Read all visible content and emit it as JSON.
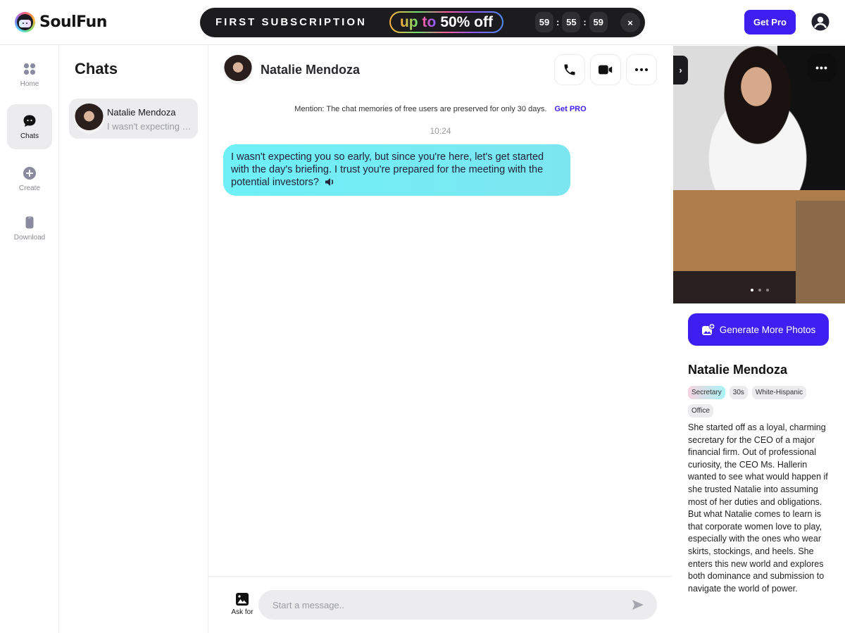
{
  "app": {
    "name": "SoulFun"
  },
  "promo": {
    "title": "FIRST SUBSCRIPTION",
    "pill_up": "up",
    "pill_to": "to",
    "pill_discount": "50% off",
    "timer": [
      "59",
      "55",
      "59"
    ],
    "timer_separator": ":",
    "close_label": "×"
  },
  "header": {
    "get_pro_label": "Get Pro",
    "user_icon": "user-circle-icon"
  },
  "nav": {
    "items": [
      {
        "label": "Home",
        "icon": "grid-icon",
        "active": false
      },
      {
        "label": "Chats",
        "icon": "chat-bubble-icon",
        "active": true
      },
      {
        "label": "Create",
        "icon": "plus-circle-icon",
        "active": false
      },
      {
        "label": "Download",
        "icon": "phone-icon",
        "active": false
      }
    ]
  },
  "chatlist": {
    "title": "Chats",
    "items": [
      {
        "name": "Natalie Mendoza",
        "preview": "I wasn't expecting you so early, but since you're here, let's get started with the day's briefing."
      }
    ]
  },
  "chat": {
    "contact_name": "Natalie Mendoza",
    "actions": [
      "phone-icon",
      "video-icon",
      "more-icon"
    ],
    "mention_text": "Mention: The chat memories of free users are preserved for only 30 days.",
    "mention_link": "Get PRO",
    "timestamp": "10:24",
    "messages": [
      {
        "from": "Natalie Mendoza",
        "text": "I wasn't expecting you so early, but since you're here, let's get started with the day's briefing. I trust you're prepared for the meeting with the potential investors?"
      }
    ],
    "composer": {
      "ask_for_label": "Ask for",
      "placeholder": "Start a message..",
      "value": ""
    }
  },
  "profile": {
    "photo_count": 3,
    "photo_active_index": 0,
    "generate_label": "Generate More Photos",
    "name": "Natalie Mendoza",
    "tags": [
      "Secretary",
      "30s",
      "White-Hispanic",
      "Office"
    ],
    "bio": "She started off as a loyal, charming secretary for the CEO of a major financial firm. Out of professional curiosity, the CEO Ms. Hallerin wanted to see what would happen if she trusted Natalie into assuming most of her duties and obligations. But what Natalie comes to learn is that corporate women love to play, especially with the ones who wear skirts, stockings, and heels. She enters this new world and explores both dominance and submission to navigate the world of power."
  },
  "colors": {
    "brand": "#3d1ff2",
    "bubble": "#6ef0f6",
    "promo_bg": "#1c1c1f",
    "muted_text": "#9a9aa4"
  }
}
